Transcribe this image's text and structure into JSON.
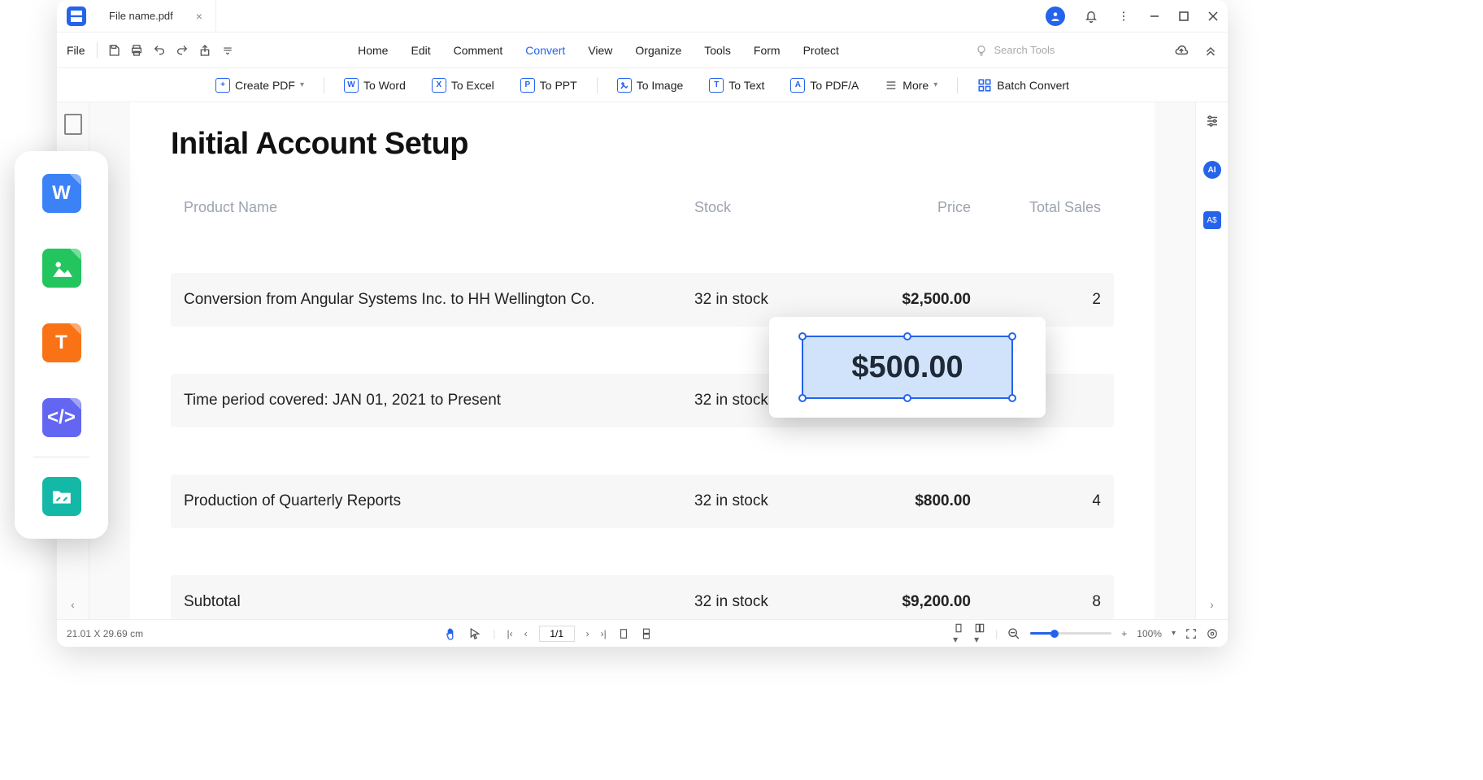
{
  "titlebar": {
    "tab": "File name.pdf"
  },
  "menubar": {
    "file": "File",
    "tabs": {
      "home": "Home",
      "edit": "Edit",
      "comment": "Comment",
      "convert": "Convert",
      "view": "View",
      "organize": "Organize",
      "tools": "Tools",
      "form": "Form",
      "protect": "Protect"
    },
    "search_placeholder": "Search Tools"
  },
  "toolbar": {
    "create": "Create PDF",
    "to_word": "To Word",
    "to_excel": "To Excel",
    "to_ppt": "To PPT",
    "to_image": "To Image",
    "to_text": "To Text",
    "to_pdfa": "To PDF/A",
    "more": "More",
    "batch": "Batch Convert"
  },
  "document": {
    "title": "Initial Account Setup",
    "columns": {
      "name": "Product Name",
      "stock": "Stock",
      "price": "Price",
      "total": "Total Sales"
    },
    "rows": [
      {
        "name": "Conversion from Angular Systems Inc. to HH Wellington Co.",
        "stock": "32 in stock",
        "price": "$2,500.00",
        "total": "2"
      },
      {
        "name": "Time period covered: JAN 01, 2021 to Present",
        "stock": "32 in stock",
        "price": "",
        "total": ""
      },
      {
        "name": "Production of Quarterly Reports",
        "stock": "32 in stock",
        "price": "$800.00",
        "total": "4"
      },
      {
        "name": "Subtotal",
        "stock": "32 in stock",
        "price": "$9,200.00",
        "total": "8"
      }
    ],
    "edit_value": "$500.00"
  },
  "statusbar": {
    "dimensions": "21.01 X 29.69 cm",
    "page": "1/1",
    "zoom": "100%"
  },
  "right_rail": {
    "ai": "AI",
    "trans": "A$"
  }
}
